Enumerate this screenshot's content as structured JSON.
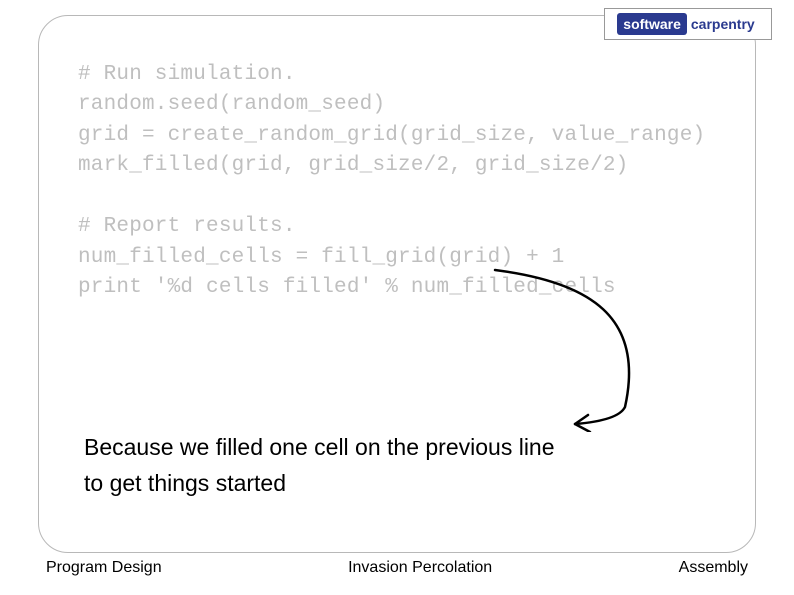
{
  "logo": {
    "left": "software",
    "right": "carpentry"
  },
  "code": {
    "line1": "# Run simulation.",
    "line2": "random.seed(random_seed)",
    "line3": "grid = create_random_grid(grid_size, value_range)",
    "line4": "mark_filled(grid, grid_size/2, grid_size/2)",
    "line5": "",
    "line6": "# Report results.",
    "line7": "num_filled_cells = fill_grid(grid) + 1",
    "line8": "print '%d cells filled' % num_filled_cells"
  },
  "annotation": {
    "line1": "Because we filled one cell on the previous line",
    "line2": "to get things started"
  },
  "footer": {
    "left": "Program Design",
    "center": "Invasion Percolation",
    "right": "Assembly"
  }
}
